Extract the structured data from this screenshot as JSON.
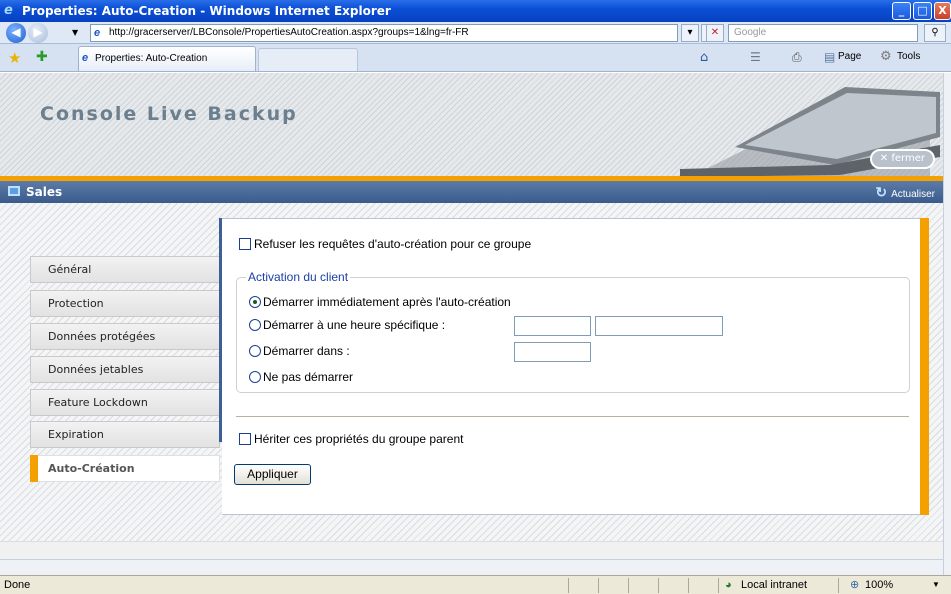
{
  "window": {
    "title": "Properties: Auto-Creation - Windows Internet Explorer",
    "minimize_label": "_",
    "maximize_label": "□",
    "close_label": "X"
  },
  "browser": {
    "back_label": "◀",
    "forward_label": "▶",
    "url": "http://gracerserver/LBConsole/PropertiesAutoCreation.aspx?groups=1&lng=fr-FR",
    "search_placeholder": "Google",
    "tab_title": "Properties: Auto-Creation",
    "page_menu": "Page",
    "tools_menu": "Tools"
  },
  "header": {
    "app_title": "Console Live Backup",
    "close_label": "fermer",
    "close_icon_glyph": "✕"
  },
  "section": {
    "name": "Sales",
    "refresh_label": "Actualiser"
  },
  "nav": {
    "items": [
      {
        "label": "Général",
        "active": false
      },
      {
        "label": "Protection",
        "active": false
      },
      {
        "label": "Données protégées",
        "active": false
      },
      {
        "label": "Données jetables",
        "active": false
      },
      {
        "label": "Feature Lockdown",
        "active": false
      },
      {
        "label": "Expiration",
        "active": false
      },
      {
        "label": "Auto-Création",
        "active": true
      }
    ]
  },
  "form": {
    "refuse_label": "Refuser les requêtes d'auto-création pour ce groupe",
    "refuse_checked": false,
    "fieldset_legend": "Activation du client",
    "options": [
      {
        "label": "Démarrer immédiatement après l'auto-création",
        "selected": true
      },
      {
        "label": "Démarrer à une heure spécifique :",
        "selected": false
      },
      {
        "label": "Démarrer dans :",
        "selected": false
      },
      {
        "label": "Ne pas démarrer",
        "selected": false
      }
    ],
    "inherit_label": "Hériter ces propriétés du groupe parent",
    "inherit_checked": false,
    "apply_label": "Appliquer"
  },
  "status": {
    "text": "Done",
    "zone": "Local intranet",
    "zoom": "100%"
  },
  "colors": {
    "accent_orange": "#f4a000",
    "section_blue": "#3a5b8c",
    "legend_blue": "#1c3fa6"
  }
}
